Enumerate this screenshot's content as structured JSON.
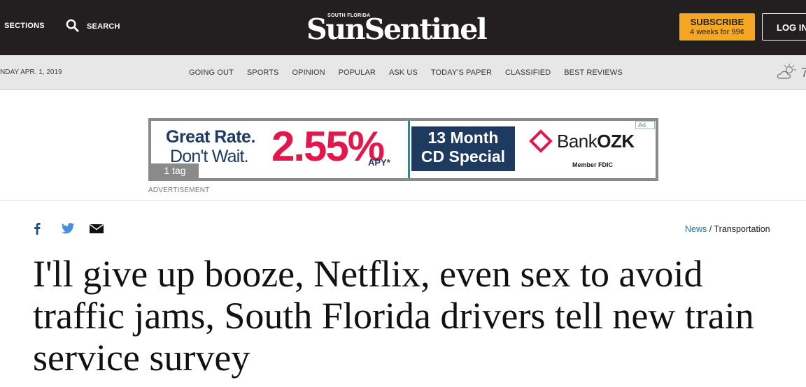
{
  "header": {
    "sections_label": "SECTIONS",
    "search_label": "SEARCH",
    "logo_small": "SOUTH FLORIDA",
    "logo_main": "SunSentinel",
    "subscribe_label": "SUBSCRIBE",
    "subscribe_offer": "4 weeks for 99¢",
    "login_label": "LOG IN"
  },
  "nav": {
    "date": "NDAY APR. 1, 2019",
    "links": [
      "GOING OUT",
      "SPORTS",
      "OPINION",
      "POPULAR",
      "ASK US",
      "TODAY'S PAPER",
      "CLASSIFIED",
      "BEST REVIEWS"
    ],
    "weather_icon": "partly-sunny-icon",
    "temperature": "7"
  },
  "ad": {
    "line1": "Great Rate.",
    "line2": "Don't Wait.",
    "rate": "2.55%",
    "apy": "APY*",
    "cd_line1": "13 Month",
    "cd_line2": "CD Special",
    "bank_name_a": "Bank",
    "bank_name_b": "OZK",
    "fdic": "Member FDIC",
    "ad_badge": "Ad",
    "tag_label": "1 tag",
    "label": "ADVERTISEMENT",
    "colors": {
      "navy": "#1e3a5f",
      "pink": "#e2174b",
      "teal": "#2d8a8a"
    }
  },
  "article": {
    "breadcrumb_section": "News",
    "breadcrumb_separator": "/",
    "breadcrumb_category": "Transportation",
    "headline": "I'll give up booze, Netflix, even sex to avoid traffic jams, South Florida drivers tell new train service survey"
  },
  "share": {
    "icons": [
      "facebook-icon",
      "twitter-icon",
      "email-icon"
    ]
  },
  "colors": {
    "header_bg": "#231f20",
    "subscribe_bg": "#f5a623",
    "nav_bg": "#e7e7e7",
    "link_blue": "#1f6fb2"
  }
}
